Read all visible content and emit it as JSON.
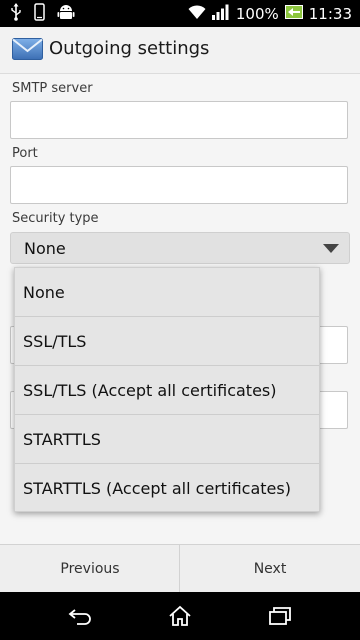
{
  "status_bar": {
    "battery_percent": "100%",
    "time": "11:33",
    "icons": [
      "usb-icon",
      "phone-icon",
      "android-icon",
      "wifi-icon",
      "signal-icon",
      "battery-icon"
    ]
  },
  "action_bar": {
    "title": "Outgoing settings",
    "icon": "email-envelope-icon"
  },
  "form": {
    "smtp_label": "SMTP server",
    "smtp_value": "",
    "port_label": "Port",
    "port_value": "",
    "security_label": "Security type",
    "security_value": "None"
  },
  "dropdown": {
    "options": [
      "None",
      "SSL/TLS",
      "SSL/TLS (Accept all certificates)",
      "STARTTLS",
      "STARTTLS (Accept all certificates)"
    ]
  },
  "buttons": {
    "previous": "Previous",
    "next": "Next"
  },
  "nav_bar": {
    "icons": [
      "back-icon",
      "home-icon",
      "recent-apps-icon"
    ]
  },
  "colors": {
    "background": "#f5f5f5",
    "status_bar": "#000000",
    "accent_icon": "#4a7fc1"
  }
}
